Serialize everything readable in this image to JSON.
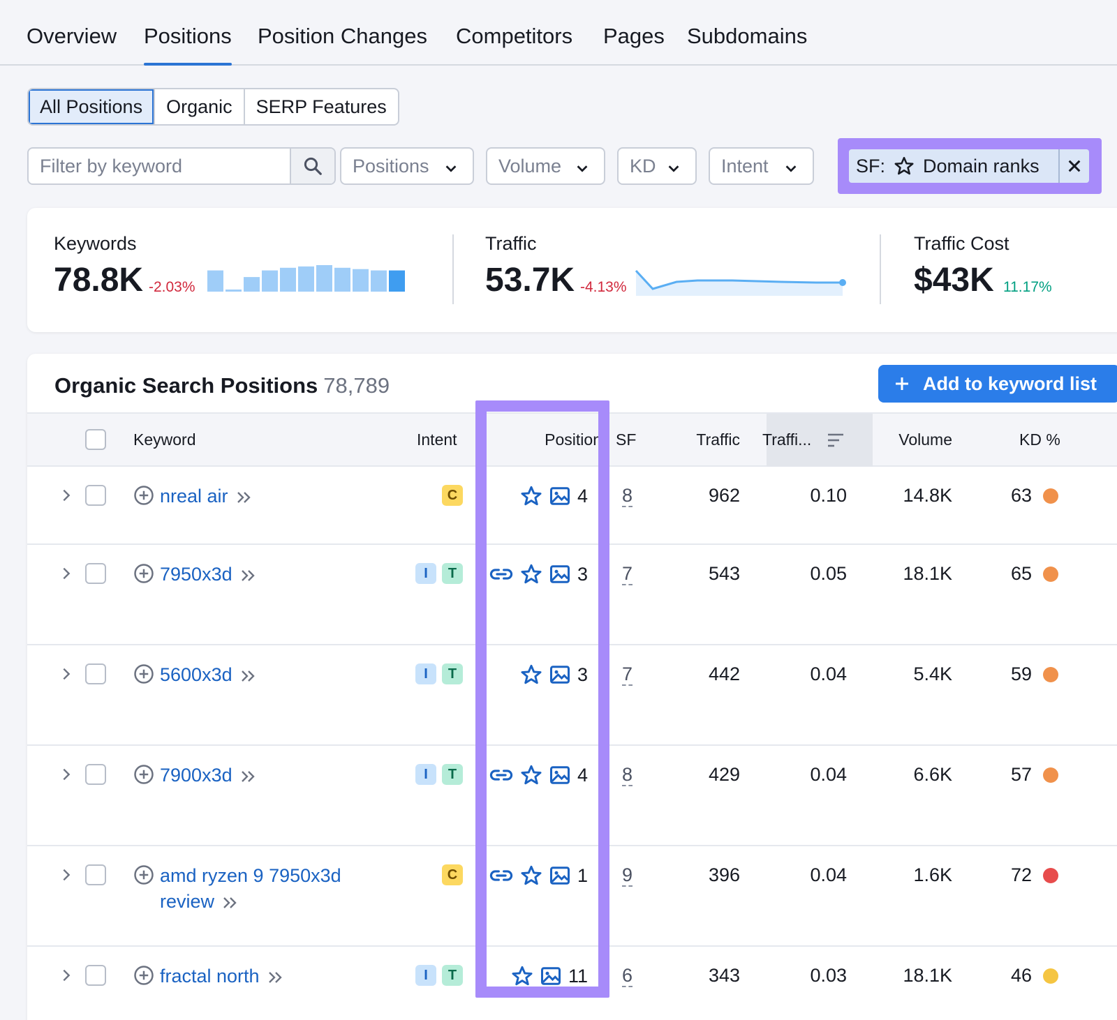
{
  "nav": {
    "tabs": [
      {
        "label": "Overview"
      },
      {
        "label": "Positions"
      },
      {
        "label": "Position Changes"
      },
      {
        "label": "Competitors"
      },
      {
        "label": "Pages"
      },
      {
        "label": "Subdomains"
      }
    ],
    "active": "Positions"
  },
  "segments": {
    "items": [
      "All Positions",
      "Organic",
      "SERP Features"
    ],
    "active": "All Positions"
  },
  "filters": {
    "keyword_placeholder": "Filter by keyword",
    "positions": "Positions",
    "volume": "Volume",
    "kd": "KD",
    "intent": "Intent",
    "sf_prefix": "SF:",
    "sf_value": "Domain ranks"
  },
  "summary": {
    "keywords": {
      "label": "Keywords",
      "value": "78.8K",
      "delta": "-2.03%",
      "bars": [
        0.8,
        0.08,
        0.55,
        0.8,
        0.9,
        0.95,
        1.0,
        0.9,
        0.85,
        0.8,
        0.8
      ]
    },
    "traffic": {
      "label": "Traffic",
      "value": "53.7K",
      "delta": "-4.13%"
    },
    "traffic_cost": {
      "label": "Traffic Cost",
      "value": "$43K",
      "delta": "11.17%"
    }
  },
  "table": {
    "title": "Organic Search Positions",
    "count": "78,789",
    "add_button": "Add to keyword list",
    "headers": {
      "keyword": "Keyword",
      "intent": "Intent",
      "position": "Position",
      "sf": "SF",
      "traffic": "Traffic",
      "traffic_pct": "Traffi...",
      "volume": "Volume",
      "kd": "KD %"
    },
    "rows": [
      {
        "keyword": "nreal air",
        "intents": [
          "C"
        ],
        "icons": [
          "star",
          "image"
        ],
        "position": "4",
        "sf": "8",
        "traffic": "962",
        "traffic_pct": "0.10",
        "volume": "14.8K",
        "kd": "63",
        "kd_color": "#f0914b"
      },
      {
        "keyword": "7950x3d",
        "intents": [
          "I",
          "T"
        ],
        "icons": [
          "link",
          "star",
          "image"
        ],
        "position": "3",
        "sf": "7",
        "traffic": "543",
        "traffic_pct": "0.05",
        "volume": "18.1K",
        "kd": "65",
        "kd_color": "#f0914b"
      },
      {
        "keyword": "5600x3d",
        "intents": [
          "I",
          "T"
        ],
        "icons": [
          "star",
          "image"
        ],
        "position": "3",
        "sf": "7",
        "traffic": "442",
        "traffic_pct": "0.04",
        "volume": "5.4K",
        "kd": "59",
        "kd_color": "#f0914b"
      },
      {
        "keyword": "7900x3d",
        "intents": [
          "I",
          "T"
        ],
        "icons": [
          "link",
          "star",
          "image"
        ],
        "position": "4",
        "sf": "8",
        "traffic": "429",
        "traffic_pct": "0.04",
        "volume": "6.6K",
        "kd": "57",
        "kd_color": "#f0914b"
      },
      {
        "keyword": "amd ryzen 9 7950x3d review",
        "intents": [
          "C"
        ],
        "icons": [
          "link",
          "star",
          "image"
        ],
        "position": "1",
        "sf": "9",
        "traffic": "396",
        "traffic_pct": "0.04",
        "volume": "1.6K",
        "kd": "72",
        "kd_color": "#e74c4c"
      },
      {
        "keyword": "fractal north",
        "intents": [
          "I",
          "T"
        ],
        "icons": [
          "star",
          "image"
        ],
        "position": "11",
        "sf": "6",
        "traffic": "343",
        "traffic_pct": "0.03",
        "volume": "18.1K",
        "kd": "46",
        "kd_color": "#f5c542"
      }
    ]
  }
}
